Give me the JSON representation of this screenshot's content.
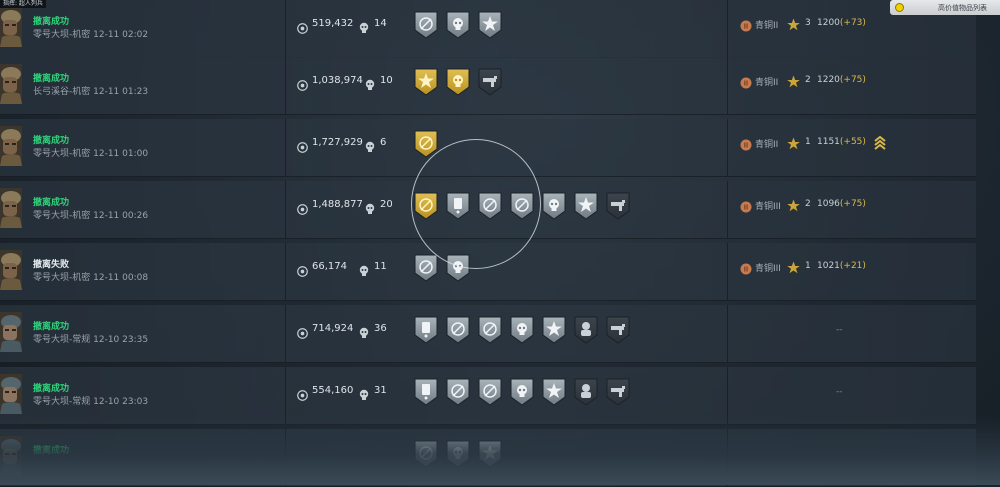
{
  "header": {
    "top_left_label": "指挥: 超人列兵",
    "filter_label": "高价值物品列表"
  },
  "records": [
    {
      "status": "撤离成功",
      "outcome": "success",
      "location": "零号大坝-机密",
      "time": "12-11 02:02",
      "coins": "519,432",
      "kills": "14",
      "avatar": "soldier-tan-helmet",
      "badges": [
        "silver-compass-badge",
        "silver-skull-badge",
        "silver-star-badge"
      ],
      "rank": "青铜II",
      "rank_color": "#c97a4d",
      "stars": "3",
      "score": "1200",
      "delta": "(+73)"
    },
    {
      "status": "撤离成功",
      "outcome": "success",
      "location": "长弓溪谷-机密",
      "time": "12-11 01:23",
      "coins": "1,038,974",
      "kills": "10",
      "avatar": "soldier-tan-helmet",
      "badges": [
        "gold-star-badge",
        "gold-skull-badge",
        "dark-weapon-badge"
      ],
      "rank": "青铜II",
      "rank_color": "#c97a4d",
      "stars": "2",
      "score": "1220",
      "delta": "(+75)"
    },
    {
      "status": "撤离成功",
      "outcome": "success",
      "location": "零号大坝-机密",
      "time": "12-11 01:00",
      "coins": "1,727,929",
      "kills": "6",
      "avatar": "soldier-tan-helmet",
      "badges": [
        "gold-target-badge"
      ],
      "rank": "青铜II",
      "rank_color": "#c97a4d",
      "stars": "1",
      "score": "1151",
      "delta": "(+55)",
      "promotion": true
    },
    {
      "status": "撤离成功",
      "outcome": "success",
      "location": "零号大坝-机密",
      "time": "12-11 00:26",
      "coins": "1,488,877",
      "kills": "20",
      "avatar": "soldier-tan-helmet",
      "badges": [
        "gold-target-badge",
        "silver-card-badge",
        "silver-compass-badge",
        "silver-compass-badge",
        "silver-skull-badge",
        "silver-star-badge",
        "dark-weapon-badge"
      ],
      "rank": "青铜III",
      "rank_color": "#c97a4d",
      "stars": "2",
      "score": "1096",
      "delta": "(+75)"
    },
    {
      "status": "撤离失败",
      "outcome": "fail",
      "location": "零号大坝-机密",
      "time": "12-11 00:08",
      "coins": "66,174",
      "kills": "11",
      "avatar": "soldier-tan-helmet",
      "badges": [
        "silver-compass-badge",
        "silver-skull-badge"
      ],
      "rank": "青铜III",
      "rank_color": "#c97a4d",
      "stars": "1",
      "score": "1021",
      "delta": "(+21)"
    },
    {
      "status": "撤离成功",
      "outcome": "success",
      "location": "零号大坝-常规",
      "time": "12-10 23:35",
      "coins": "714,924",
      "kills": "36",
      "avatar": "soldier-cap",
      "badges": [
        "silver-card-badge",
        "silver-compass-badge",
        "silver-compass-badge",
        "silver-skull-badge",
        "silver-star-badge",
        "dark-soldier-badge",
        "dark-weapon-badge"
      ],
      "rank": "",
      "placeholder": "--"
    },
    {
      "status": "撤离成功",
      "outcome": "success",
      "location": "零号大坝-常规",
      "time": "12-10 23:03",
      "coins": "554,160",
      "kills": "31",
      "avatar": "soldier-cap",
      "badges": [
        "silver-card-badge",
        "silver-compass-badge",
        "silver-compass-badge",
        "silver-skull-badge",
        "silver-star-badge",
        "dark-soldier-badge",
        "dark-weapon-badge"
      ],
      "rank": "",
      "placeholder": "--"
    },
    {
      "status": "撤离成功",
      "outcome": "success",
      "location": "",
      "time": "",
      "coins": "",
      "kills": "",
      "avatar": "soldier-cap",
      "badges": [
        "silver-compass-badge",
        "silver-skull-badge",
        "silver-star-badge"
      ],
      "rank": "",
      "placeholder": ""
    }
  ],
  "colors": {
    "success": "#2fd37a",
    "fail": "#e7ecef",
    "gold": "#c9a53a",
    "silver": "#9aa4ac",
    "delta": "#d9b94a"
  }
}
